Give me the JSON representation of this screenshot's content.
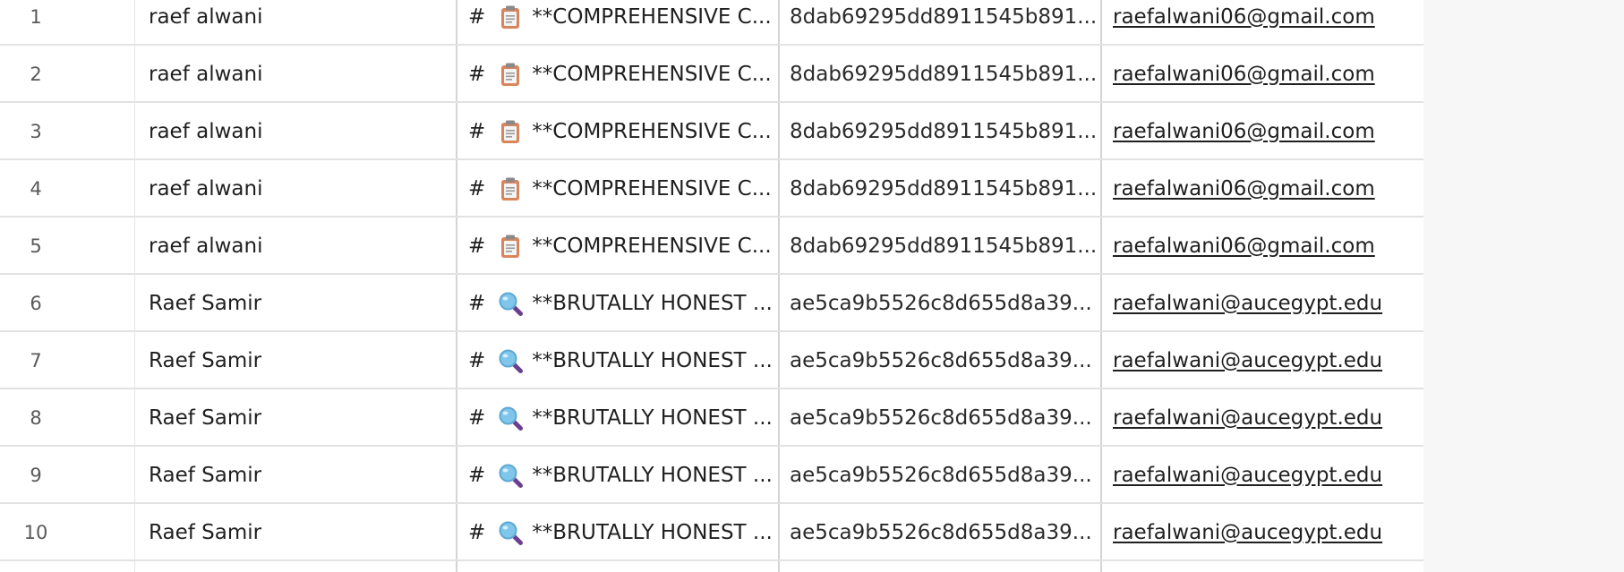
{
  "rows": [
    {
      "num": "1",
      "name": "raef alwani",
      "hash_mark": "#",
      "icon": "clipboard-icon",
      "prompt": "**COMPREHENSIVE C...",
      "hash": "8dab69295dd8911545b891...",
      "email": "raefalwani06@gmail.com"
    },
    {
      "num": "2",
      "name": "raef alwani",
      "hash_mark": "#",
      "icon": "clipboard-icon",
      "prompt": "**COMPREHENSIVE C...",
      "hash": "8dab69295dd8911545b891...",
      "email": "raefalwani06@gmail.com"
    },
    {
      "num": "3",
      "name": "raef alwani",
      "hash_mark": "#",
      "icon": "clipboard-icon",
      "prompt": "**COMPREHENSIVE C...",
      "hash": "8dab69295dd8911545b891...",
      "email": "raefalwani06@gmail.com"
    },
    {
      "num": "4",
      "name": "raef alwani",
      "hash_mark": "#",
      "icon": "clipboard-icon",
      "prompt": "**COMPREHENSIVE C...",
      "hash": "8dab69295dd8911545b891...",
      "email": "raefalwani06@gmail.com"
    },
    {
      "num": "5",
      "name": "raef alwani",
      "hash_mark": "#",
      "icon": "clipboard-icon",
      "prompt": "**COMPREHENSIVE C...",
      "hash": "8dab69295dd8911545b891...",
      "email": "raefalwani06@gmail.com"
    },
    {
      "num": "6",
      "name": "Raef Samir",
      "hash_mark": "#",
      "icon": "magnifying-glass-icon",
      "prompt": "**BRUTALLY HONEST ...",
      "hash": "ae5ca9b5526c8d655d8a39...",
      "email": "raefalwani@aucegypt.edu"
    },
    {
      "num": "7",
      "name": "Raef Samir",
      "hash_mark": "#",
      "icon": "magnifying-glass-icon",
      "prompt": "**BRUTALLY HONEST ...",
      "hash": "ae5ca9b5526c8d655d8a39...",
      "email": "raefalwani@aucegypt.edu"
    },
    {
      "num": "8",
      "name": "Raef Samir",
      "hash_mark": "#",
      "icon": "magnifying-glass-icon",
      "prompt": "**BRUTALLY HONEST ...",
      "hash": "ae5ca9b5526c8d655d8a39...",
      "email": "raefalwani@aucegypt.edu"
    },
    {
      "num": "9",
      "name": "Raef Samir",
      "hash_mark": "#",
      "icon": "magnifying-glass-icon",
      "prompt": "**BRUTALLY HONEST ...",
      "hash": "ae5ca9b5526c8d655d8a39...",
      "email": "raefalwani@aucegypt.edu"
    },
    {
      "num": "10",
      "name": "Raef Samir",
      "hash_mark": "#",
      "icon": "magnifying-glass-icon",
      "prompt": "**BRUTALLY HONEST ...",
      "hash": "ae5ca9b5526c8d655d8a39...",
      "email": "raefalwani@aucegypt.edu"
    }
  ]
}
